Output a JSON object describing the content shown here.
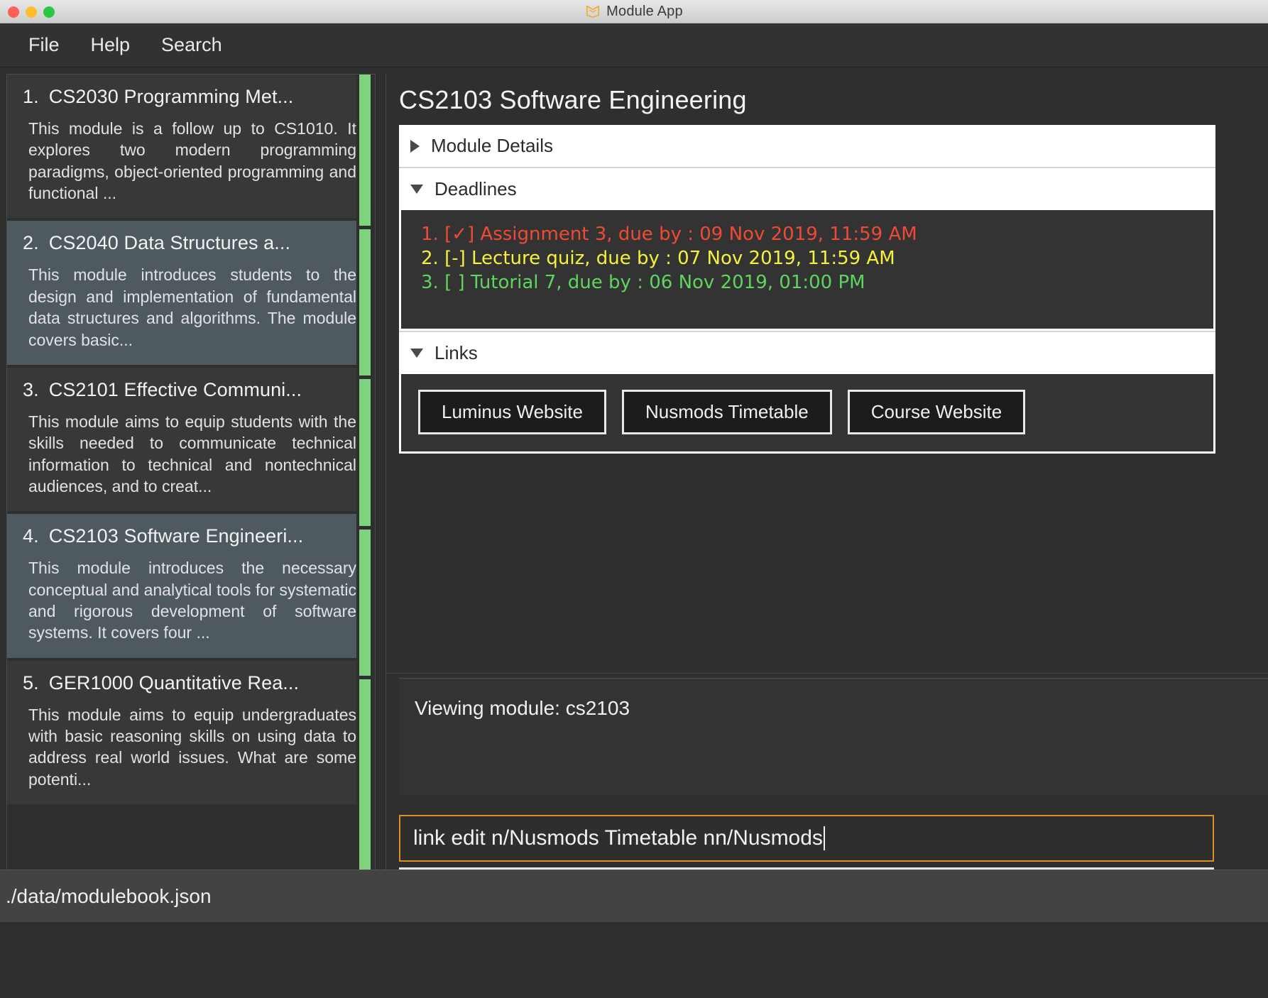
{
  "window": {
    "title": "Module App",
    "app_icon": "book-icon",
    "traffic_lights": [
      "close-red",
      "minimize-yellow",
      "zoom-green"
    ]
  },
  "menubar": {
    "items": [
      {
        "label": "File"
      },
      {
        "label": "Help"
      },
      {
        "label": "Search"
      }
    ]
  },
  "module_list": {
    "items": [
      {
        "index": "1.",
        "title": "CS2030 Programming Met...",
        "description": "This module is a follow up to CS1010. It explores two modern programming paradigms, object-oriented programming and functional ...",
        "selected": false
      },
      {
        "index": "2.",
        "title": "CS2040 Data Structures a...",
        "description": "This module introduces students to the design and implementation of fundamental data structures and algorithms. The module covers basic...",
        "selected": true
      },
      {
        "index": "3.",
        "title": "CS2101 Effective Communi...",
        "description": "This module aims to equip students with the skills needed to communicate technical information to technical and nontechnical audiences, and to creat...",
        "selected": false
      },
      {
        "index": "4.",
        "title": "CS2103 Software Engineeri...",
        "description": "This module introduces the necessary conceptual and analytical tools for systematic and rigorous development of software systems. It covers four ...",
        "selected": true
      },
      {
        "index": "5.",
        "title": "GER1000 Quantitative Rea...",
        "description": "This module aims to equip undergraduates with basic reasoning skills on using data to address real world issues. What are some potenti...",
        "selected": false
      }
    ]
  },
  "detail": {
    "title": "CS2103 Software Engineering",
    "sections": {
      "module_details": {
        "label": "Module Details",
        "expanded": false,
        "arrow": "chevron-right-icon"
      },
      "deadlines": {
        "label": "Deadlines",
        "expanded": true,
        "arrow": "chevron-down-icon"
      },
      "links": {
        "label": "Links",
        "expanded": true,
        "arrow": "chevron-down-icon"
      }
    },
    "deadlines": [
      {
        "text": "1. [✓] Assignment 3, due by : 09 Nov 2019, 11:59 AM",
        "color": "#f04a34"
      },
      {
        "text": "2. [-] Lecture quiz, due by : 07 Nov 2019, 11:59 AM",
        "color": "#f5f13c"
      },
      {
        "text": "3. [ ] Tutorial 7, due by : 06 Nov 2019, 01:00 PM",
        "color": "#5fd45f"
      }
    ],
    "links": [
      {
        "label": "Luminus Website"
      },
      {
        "label": "Nusmods Timetable"
      },
      {
        "label": "Course Website"
      }
    ]
  },
  "result": {
    "text": "Viewing module: cs2103"
  },
  "command": {
    "value": "link edit n/Nusmods Timetable nn/Nusmods",
    "placeholder": "Enter command here...",
    "border_color": "#d9902b"
  },
  "footer": {
    "path": "./data/modulebook.json"
  },
  "colors": {
    "scrollbar_green": "#7fd37f",
    "selected_row": "#4e5a60",
    "row": "#383838",
    "panel_bg": "#2f2f2f"
  }
}
